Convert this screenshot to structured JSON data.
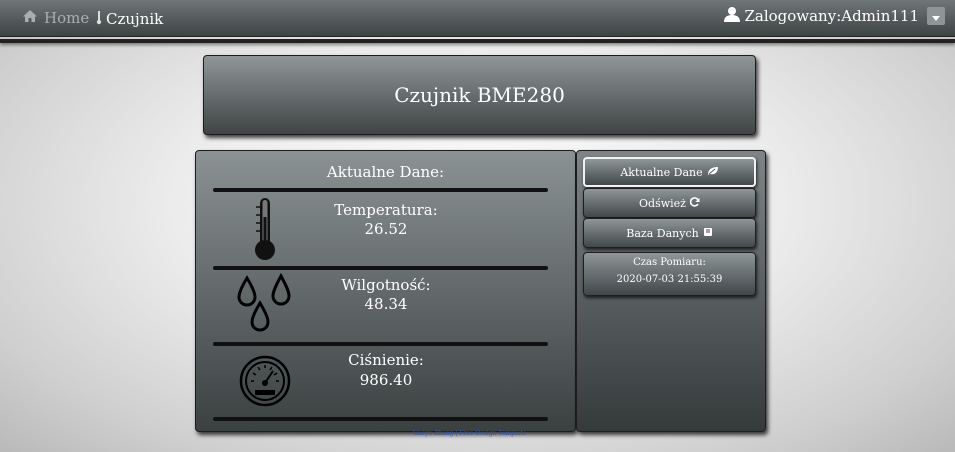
{
  "nav": {
    "home_label": "Home",
    "current_label": "Czujnik",
    "user_label": "Zalogowany:Admin111"
  },
  "title_card": {
    "title": "Czujnik BME280"
  },
  "data_card": {
    "heading": "Aktualne Dane:",
    "readings": [
      {
        "label": "Temperatura:",
        "value": "26.52",
        "icon": "thermometer-icon"
      },
      {
        "label": "Wilgotność:",
        "value": "48.34",
        "icon": "water-drops-icon"
      },
      {
        "label": "Ciśnienie:",
        "value": "986.40",
        "icon": "pressure-gauge-icon"
      }
    ]
  },
  "side_menu": {
    "buttons": [
      {
        "label": "Aktualne Dane",
        "icon": "leaf-icon",
        "active": true
      },
      {
        "label": "Odśwież",
        "icon": "refresh-icon",
        "active": false
      },
      {
        "label": "Baza Danych",
        "icon": "book-icon",
        "active": false
      }
    ],
    "time_label": "Czas Pomiaru:",
    "time_value": "2020-07-03 21:55:39"
  },
  "footer": {
    "text": "Gaoyu Zhang | Free Design Template"
  },
  "colors": {
    "panel_top": "#8a9293",
    "panel_bottom": "#3b4041",
    "navbar": "#3e4344",
    "text": "#ffffff"
  }
}
